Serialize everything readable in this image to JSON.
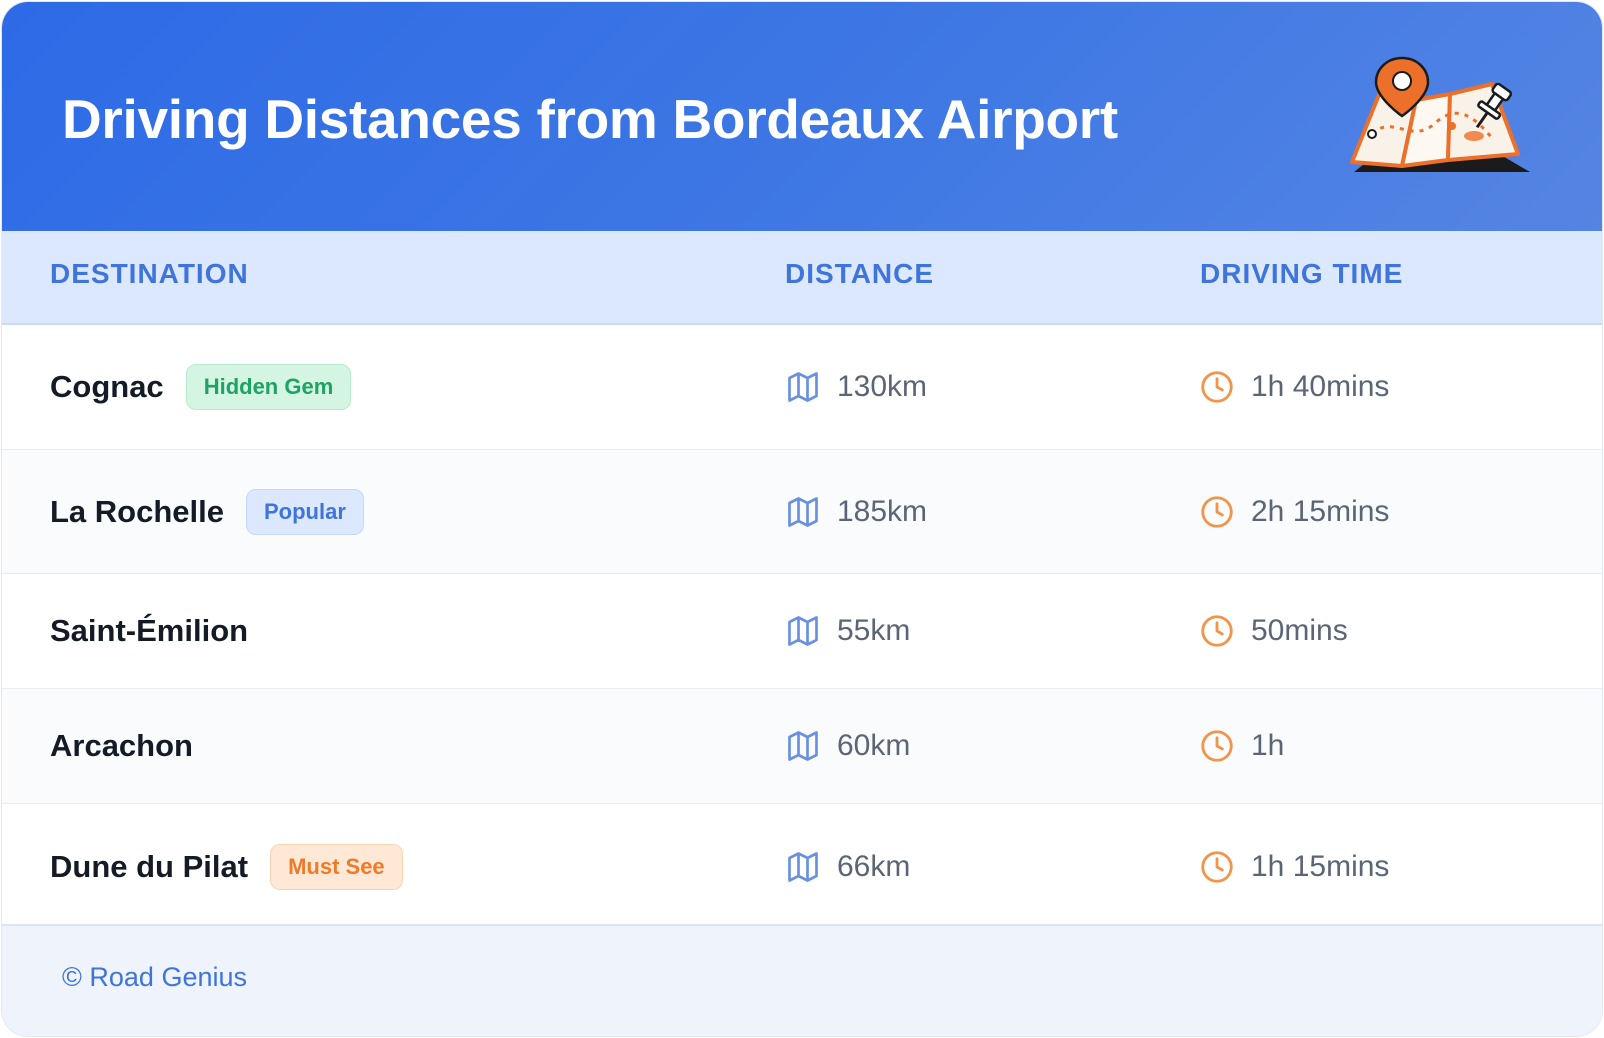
{
  "header": {
    "title": "Driving Distances from Bordeaux Airport",
    "illustration": "map-pin-illustration"
  },
  "columns": {
    "destination": "DESTINATION",
    "distance": "DISTANCE",
    "driving_time": "DRIVING TIME"
  },
  "rows": [
    {
      "destination": "Cognac",
      "badge": "Hidden Gem",
      "badge_color": "#1ea365",
      "distance": "130km",
      "time": "1h 40mins"
    },
    {
      "destination": "La Rochelle",
      "badge": "Popular",
      "badge_color": "#3f74db",
      "distance": "185km",
      "time": "2h 15mins"
    },
    {
      "destination": "Saint-Émilion",
      "badge": "",
      "distance": "55km",
      "time": "50mins"
    },
    {
      "destination": "Arcachon",
      "badge": "",
      "distance": "60km",
      "time": "1h"
    },
    {
      "destination": "Dune du Pilat",
      "badge": "Must See",
      "badge_color": "#ee7b2a",
      "distance": "66km",
      "time": "1h 15mins"
    }
  ],
  "icons": {
    "distance": "map-icon",
    "time": "clock-icon"
  },
  "footer": {
    "text": "© Road Genius"
  },
  "colors": {
    "header": "#3f78e4",
    "accent": "#3f74db",
    "clock": "#f0954c",
    "map": "#6a91e0"
  }
}
